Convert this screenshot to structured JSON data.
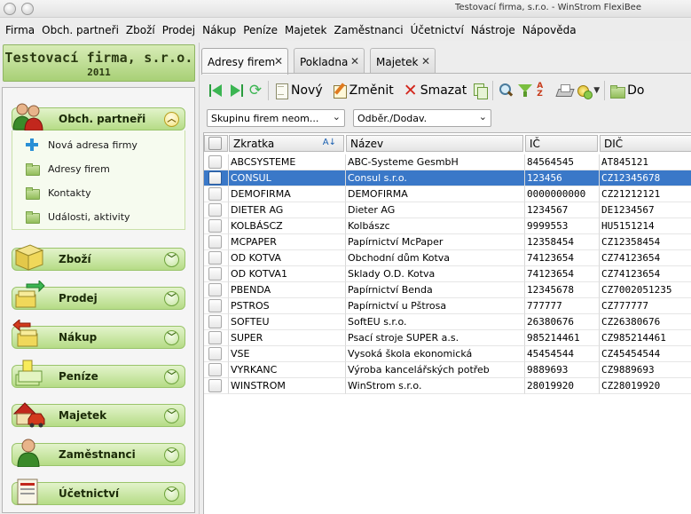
{
  "window": {
    "title": "Testovací firma, s.r.o. - WinStrom FlexiBee"
  },
  "menu": [
    "Firma",
    "Obch. partneři",
    "Zboží",
    "Prodej",
    "Nákup",
    "Peníze",
    "Majetek",
    "Zaměstnanci",
    "Účetnictví",
    "Nástroje",
    "Nápověda"
  ],
  "company": {
    "name": "Testovací firma, s.r.o.",
    "year": "2011"
  },
  "sidebar": {
    "sections": [
      {
        "label": "Obch. partneři",
        "icon": "business-partners-icon",
        "expanded": true
      },
      {
        "label": "Zboží",
        "icon": "goods-icon",
        "expanded": false
      },
      {
        "label": "Prodej",
        "icon": "sales-icon",
        "expanded": false
      },
      {
        "label": "Nákup",
        "icon": "purchase-icon",
        "expanded": false
      },
      {
        "label": "Peníze",
        "icon": "money-icon",
        "expanded": false
      },
      {
        "label": "Majetek",
        "icon": "property-icon",
        "expanded": false
      },
      {
        "label": "Zaměstnanci",
        "icon": "employees-icon",
        "expanded": false
      },
      {
        "label": "Účetnictví",
        "icon": "accounting-icon",
        "expanded": false
      }
    ],
    "subitems": [
      {
        "label": "Nová adresa firmy",
        "icon": "plus-icon"
      },
      {
        "label": "Adresy firem",
        "icon": "folder-icon"
      },
      {
        "label": "Kontakty",
        "icon": "folder-icon"
      },
      {
        "label": "Události, aktivity",
        "icon": "folder-icon"
      }
    ]
  },
  "tabs": [
    {
      "label": "Adresy firem",
      "active": true
    },
    {
      "label": "Pokladna",
      "active": false
    },
    {
      "label": "Majetek",
      "active": false
    }
  ],
  "toolbar": {
    "new_label": "Nový",
    "edit_label": "Změnit",
    "delete_label": "Smazat",
    "more_label": "Do"
  },
  "filters": {
    "group": "Skupinu firem neom...",
    "type": "Odběr./Dodav."
  },
  "table": {
    "columns": [
      "Zkratka",
      "Název",
      "IČ",
      "DIČ"
    ],
    "sort_indicator": "A↓",
    "rows": [
      {
        "zkratka": "ABCSYSTEME",
        "nazev": "ABC-Systeme GesmbH",
        "ic": "84564545",
        "dic": "AT845121",
        "selected": false
      },
      {
        "zkratka": "CONSUL",
        "nazev": "Consul s.r.o.",
        "ic": "123456",
        "dic": "CZ12345678",
        "selected": true
      },
      {
        "zkratka": "DEMOFIRMA",
        "nazev": "DEMOFIRMA",
        "ic": "0000000000",
        "dic": "CZ21212121",
        "selected": false
      },
      {
        "zkratka": "DIETER AG",
        "nazev": "Dieter AG",
        "ic": "1234567",
        "dic": "DE1234567",
        "selected": false
      },
      {
        "zkratka": "KOLBÁSCZ",
        "nazev": "Kolbászc",
        "ic": "9999553",
        "dic": "HU5151214",
        "selected": false
      },
      {
        "zkratka": "MCPAPER",
        "nazev": "Papírnictví McPaper",
        "ic": "12358454",
        "dic": "CZ12358454",
        "selected": false
      },
      {
        "zkratka": "OD KOTVA",
        "nazev": "Obchodní dům Kotva",
        "ic": "74123654",
        "dic": "CZ74123654",
        "selected": false
      },
      {
        "zkratka": "OD KOTVA1",
        "nazev": "Sklady O.D. Kotva",
        "ic": "74123654",
        "dic": "CZ74123654",
        "selected": false
      },
      {
        "zkratka": "PBENDA",
        "nazev": "Papírnictví Benda",
        "ic": "12345678",
        "dic": "CZ7002051235",
        "selected": false
      },
      {
        "zkratka": "PSTROS",
        "nazev": "Papírnictví u Pštrosa",
        "ic": "777777",
        "dic": "CZ777777",
        "selected": false
      },
      {
        "zkratka": "SOFTEU",
        "nazev": "SoftEU s.r.o.",
        "ic": "26380676",
        "dic": "CZ26380676",
        "selected": false
      },
      {
        "zkratka": "SUPER",
        "nazev": "Psací stroje SUPER a.s.",
        "ic": "985214461",
        "dic": "CZ985214461",
        "selected": false
      },
      {
        "zkratka": "VSE",
        "nazev": "Vysoká škola ekonomická",
        "ic": "45454544",
        "dic": "CZ45454544",
        "selected": false
      },
      {
        "zkratka": "VYRKANC",
        "nazev": "Výroba kancelářských potřeb",
        "ic": "9889693",
        "dic": "CZ9889693",
        "selected": false
      },
      {
        "zkratka": "WINSTROM",
        "nazev": "WinStrom s.r.o.",
        "ic": "28019920",
        "dic": "CZ28019920",
        "selected": false
      }
    ]
  },
  "colors": {
    "section_green": "#b5dc86",
    "selection_blue": "#3a78c8"
  }
}
